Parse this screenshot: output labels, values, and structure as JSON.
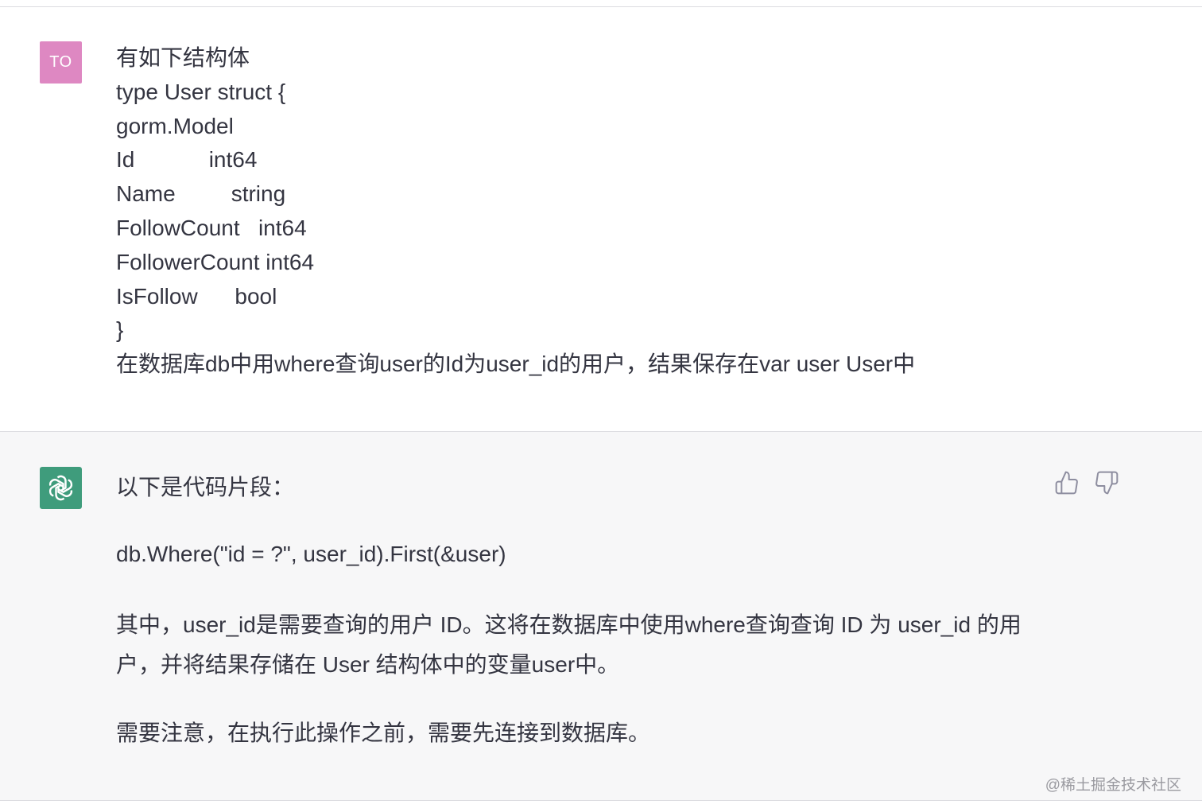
{
  "user_message": {
    "avatar_initials": "TO",
    "avatar_color": "#de88c2",
    "lines": [
      "有如下结构体",
      "type User struct {",
      "gorm.Model",
      "Id            int64",
      "Name         string",
      "FollowCount   int64",
      "FollowerCount int64",
      "IsFollow      bool",
      "}",
      "在数据库db中用where查询user的Id为user_id的用户，结果保存在var user User中"
    ]
  },
  "assistant_message": {
    "avatar_icon": "openai-logo-icon",
    "avatar_color": "#3f9c7c",
    "intro": "以下是代码片段：",
    "code": "db.Where(\"id = ?\", user_id).First(&user)",
    "explanation": "其中，user_id是需要查询的用户 ID。这将在数据库中使用where查询查询 ID 为 user_id 的用户，并将结果存储在 User 结构体中的变量user中。",
    "note": "需要注意，在执行此操作之前，需要先连接到数据库。",
    "feedback": {
      "like_icon": "thumbs-up-icon",
      "dislike_icon": "thumbs-down-icon"
    }
  },
  "watermark": "@稀土掘金技术社区"
}
